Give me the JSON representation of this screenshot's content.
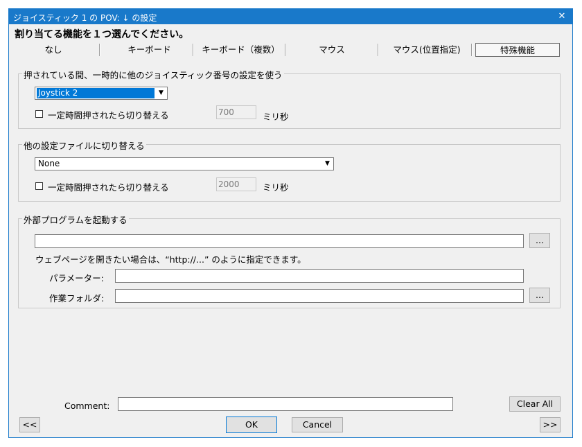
{
  "window": {
    "title": "ジョイスティック 1 の POV: ↓ の設定",
    "close": "✕"
  },
  "heading": "割り当てる機能を１つ選んでください。",
  "tabs": [
    "なし",
    "キーボード",
    "キーボード（複数）",
    "マウス",
    "マウス(位置指定)",
    "特殊機能"
  ],
  "group1": {
    "title": "押されている間、一時的に他のジョイスティック番号の設定を使う",
    "select_value": "Joystick 2",
    "check_label": "一定時間押されたら切り替える",
    "ms_value": "700",
    "ms_unit": "ミリ秒"
  },
  "group2": {
    "title": "他の設定ファイルに切り替える",
    "select_value": "None",
    "check_label": "一定時間押されたら切り替える",
    "ms_value": "2000",
    "ms_unit": "ミリ秒"
  },
  "group3": {
    "title": "外部プログラムを起動する",
    "path_value": "",
    "browse_label": "...",
    "hint": "ウェブページを開きたい場合は、“http://...” のように指定できます。",
    "param_label": "パラメーター:",
    "param_value": "",
    "workdir_label": "作業フォルダ:",
    "workdir_value": "",
    "browse2_label": "..."
  },
  "footer": {
    "comment_label": "Comment:",
    "comment_value": "",
    "clear_all": "Clear All",
    "prev": "<<",
    "ok": "OK",
    "cancel": "Cancel",
    "next": ">>"
  },
  "colors": {
    "titlebar": "#1979ca",
    "selection": "#0078d7",
    "window_bg": "#f0f0f0"
  }
}
